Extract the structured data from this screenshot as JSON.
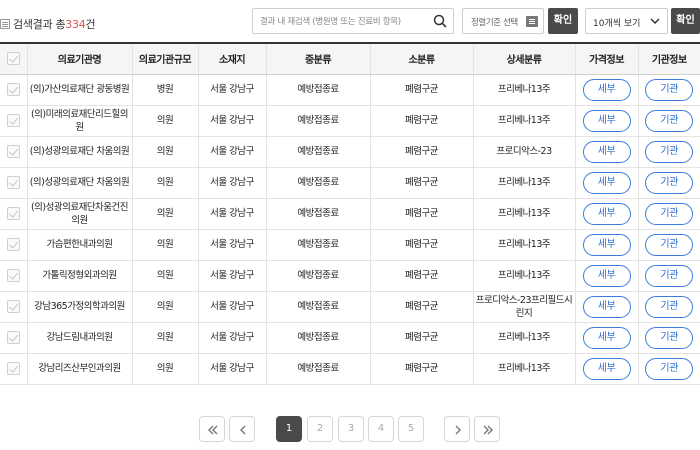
{
  "result": {
    "prefix": "검색결과 총 ",
    "count": "334",
    "suffix": "건"
  },
  "search": {
    "placeholder": "결과 내 재검색 (병원명 또는 진료비 항목)"
  },
  "sort": {
    "label": "정렬기준 선택"
  },
  "buttons": {
    "confirm": "확인",
    "detail": "세부",
    "institution": "기관"
  },
  "per_page": {
    "selected": "10개씩 보기"
  },
  "table": {
    "headers": [
      "",
      "의료기관명",
      "의료기관규모",
      "소재지",
      "중분류",
      "소분류",
      "상세분류",
      "가격정보",
      "기관정보"
    ],
    "rows": [
      {
        "name": "(의)가산의료재단 광동병원",
        "scale": "병원",
        "location": "서울 강남구",
        "mid": "예방접종료",
        "sub": "폐렴구균",
        "detail": "프리베나13주"
      },
      {
        "name": "(의)미래의료재단리드힐의원",
        "scale": "의원",
        "location": "서울 강남구",
        "mid": "예방접종료",
        "sub": "폐렴구균",
        "detail": "프리베나13주"
      },
      {
        "name": "(의)성광의료재단 차움의원",
        "scale": "의원",
        "location": "서울 강남구",
        "mid": "예방접종료",
        "sub": "폐렴구균",
        "detail": "프로디악스-23"
      },
      {
        "name": "(의)성광의료재단 차움의원",
        "scale": "의원",
        "location": "서울 강남구",
        "mid": "예방접종료",
        "sub": "폐렴구균",
        "detail": "프리베나13주"
      },
      {
        "name": "(의)성광의료재단차움건진의원",
        "scale": "의원",
        "location": "서울 강남구",
        "mid": "예방접종료",
        "sub": "폐렴구균",
        "detail": "프리베나13주"
      },
      {
        "name": "가슴편한내과의원",
        "scale": "의원",
        "location": "서울 강남구",
        "mid": "예방접종료",
        "sub": "폐렴구균",
        "detail": "프리베나13주"
      },
      {
        "name": "가톨릭정형외과의원",
        "scale": "의원",
        "location": "서울 강남구",
        "mid": "예방접종료",
        "sub": "폐렴구균",
        "detail": "프리베나13주"
      },
      {
        "name": "강남365가정의학과의원",
        "scale": "의원",
        "location": "서울 강남구",
        "mid": "예방접종료",
        "sub": "폐렴구균",
        "detail": "프로디악스-23프리필드시린지"
      },
      {
        "name": "강남드림내과의원",
        "scale": "의원",
        "location": "서울 강남구",
        "mid": "예방접종료",
        "sub": "폐렴구균",
        "detail": "프리베나13주"
      },
      {
        "name": "강남리즈산부인과의원",
        "scale": "의원",
        "location": "서울 강남구",
        "mid": "예방접종료",
        "sub": "폐렴구균",
        "detail": "프리베나13주"
      }
    ]
  },
  "pagination": {
    "pages": [
      "1",
      "2",
      "3",
      "4",
      "5"
    ],
    "current": "1"
  }
}
